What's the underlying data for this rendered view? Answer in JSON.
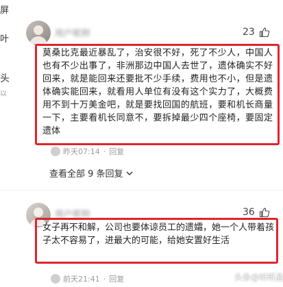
{
  "left_strip": {
    "line1": "屏",
    "line2": "叶",
    "line3": "头",
    "line4": "以"
  },
  "comments": [
    {
      "username": "用户昵称",
      "likes": "23",
      "text": "莫桑比克最近暴乱了，治安很不好，死了不少人，中国人也有不少出事了，非洲那边中国人去世了，遗体确实不好回来，就是能回来还要批不少手续，费用也不小，但是遗体确实能回来，就看用人单位有没有这个实力了，大概费用不到十万美金吧，就是要找回国的航班，要和机长商量一下，主要看机长同意不，要拆掉最少四个座椅，要固定遗体",
      "time": "昨天07:14",
      "reply_label": "回复",
      "dot": "·"
    },
    {
      "username": "用户昵称",
      "likes": "36",
      "text": "女子再不和解，公司也要体谅员工的遗孀，她一个人带着孩子太不容易了，进最大的可能，给她安置好生活",
      "time": "前天21:41",
      "reply_label": "回复",
      "dot": "·"
    }
  ],
  "reply_toggle": "查看全部 9 条回复",
  "watermark": "头条@听昕晶",
  "colors": {
    "highlight_border": "#e0242b",
    "meta_text": "#9a9a9a"
  }
}
